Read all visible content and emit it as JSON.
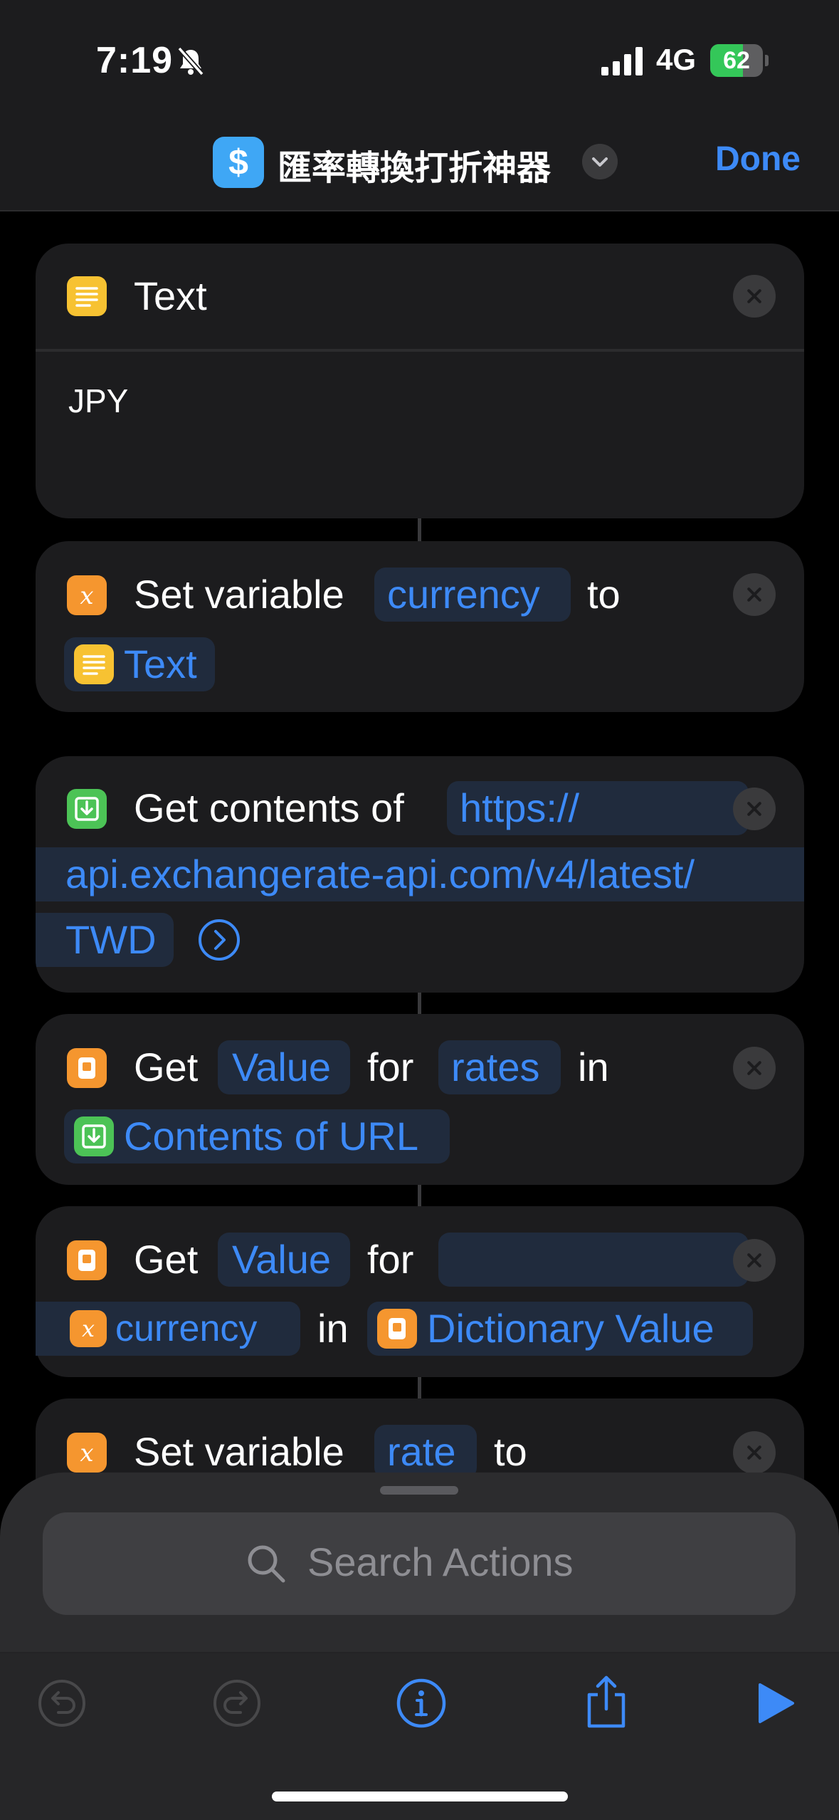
{
  "status_bar": {
    "time": "7:19",
    "network": "4G",
    "battery": "62",
    "battery_level": 0.62
  },
  "nav": {
    "app_icon_glyph": "$",
    "title": "匯率轉換打折神器",
    "done_label": "Done"
  },
  "actions": [
    {
      "type": "text",
      "label": "Text",
      "body": "JPY"
    },
    {
      "type": "set-variable",
      "prefix": "Set variable",
      "variable": "currency",
      "to_word": "to",
      "value": "Text"
    },
    {
      "type": "get-contents",
      "prefix": "Get contents of",
      "url_line1": "https://",
      "url_line2": "api.exchangerate-api.com/v4/latest/",
      "url_line3": "TWD"
    },
    {
      "type": "get-value",
      "get_word": "Get",
      "value_word": "Value",
      "for_word": "for",
      "key": "rates",
      "in_word": "in",
      "source": "Contents of URL"
    },
    {
      "type": "get-value",
      "get_word": "Get",
      "value_word": "Value",
      "for_word": "for",
      "key": "currency",
      "in_word": "in",
      "source": "Dictionary Value"
    },
    {
      "type": "set-variable",
      "prefix": "Set variable",
      "variable": "rate",
      "to_word": "to"
    }
  ],
  "search": {
    "placeholder": "Search Actions"
  },
  "colors": {
    "accent": "#3d8af7",
    "text_icon": "#f7c232",
    "variable_icon": "#f5962f",
    "url_icon": "#4cc356"
  }
}
